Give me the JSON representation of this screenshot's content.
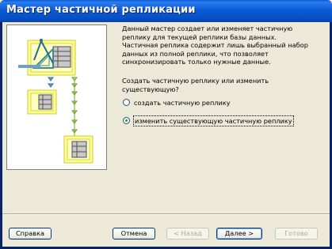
{
  "window": {
    "title": "Мастер частичной репликации"
  },
  "description": "Данный мастер создает или изменяет частичную\nреплику для текущей реплики базы данных.\nЧастичная реплика содержит лишь выбранный набор\nданных из полной реплики, что позволяет\nсинхронизировать только нужные данные.",
  "question": "Создать частичную реплику или изменить\nсуществующую?",
  "options": [
    {
      "label": "создать частичную реплику",
      "checked": false
    },
    {
      "label": "изменить существующую частичную реплику",
      "checked": true
    }
  ],
  "buttons": {
    "help": "Справка",
    "cancel": "Отмена",
    "back": "< Назад",
    "next": "Далее >",
    "finish": "Готово"
  },
  "colors": {
    "title_bar": "#0a5bd6",
    "face": "#ece9d8",
    "art_yellow": "#ffff80",
    "art_blue": "#6fa0c8"
  }
}
